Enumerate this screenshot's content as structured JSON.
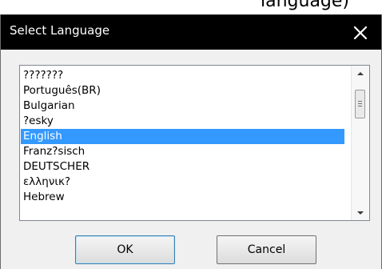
{
  "background_fragment": "language)",
  "dialog": {
    "title": "Select Language",
    "close_glyph": "✕",
    "language_list": {
      "items": [
        {
          "label": "???????",
          "selected": false
        },
        {
          "label": "Português(BR)",
          "selected": false
        },
        {
          "label": "Bulgarian",
          "selected": false
        },
        {
          "label": "?esky",
          "selected": false
        },
        {
          "label": "English",
          "selected": true
        },
        {
          "label": "Franz?sisch",
          "selected": false
        },
        {
          "label": "DEUTSCHER",
          "selected": false
        },
        {
          "label": "ελληνικ?",
          "selected": false
        },
        {
          "label": "Hebrew",
          "selected": false
        }
      ],
      "selected_value": "English"
    },
    "buttons": {
      "ok_label": "OK",
      "cancel_label": "Cancel"
    },
    "colors": {
      "titlebar": "#000000",
      "selection": "#3399ff",
      "dialog_body": "#f0f0f0"
    }
  }
}
